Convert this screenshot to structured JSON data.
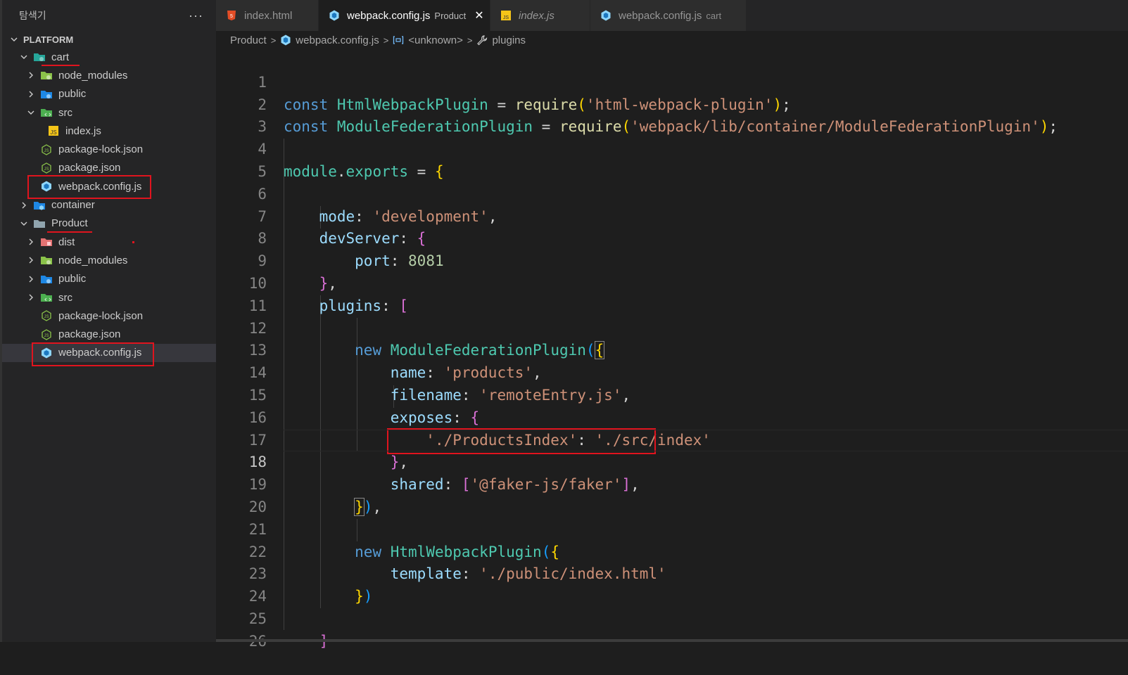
{
  "explorer": {
    "title": "탐색기",
    "more": "···",
    "root": "PLATFORM",
    "items": [
      {
        "label": "cart",
        "kind": "folder-open",
        "icon": "cart-folder-icon"
      },
      {
        "label": "node_modules",
        "kind": "folder",
        "icon": "node-folder-icon"
      },
      {
        "label": "public",
        "kind": "folder",
        "icon": "public-folder-icon"
      },
      {
        "label": "src",
        "kind": "folder-open",
        "icon": "src-folder-icon"
      },
      {
        "label": "index.js",
        "kind": "file",
        "icon": "js-file-icon"
      },
      {
        "label": "package-lock.json",
        "kind": "file",
        "icon": "nodejs-file-icon"
      },
      {
        "label": "package.json",
        "kind": "file",
        "icon": "nodejs-file-icon"
      },
      {
        "label": "webpack.config.js",
        "kind": "file",
        "icon": "webpack-icon"
      },
      {
        "label": "container",
        "kind": "folder",
        "icon": "container-folder-icon"
      },
      {
        "label": "Product",
        "kind": "folder-open",
        "icon": "folder-icon"
      },
      {
        "label": "dist",
        "kind": "folder",
        "icon": "dist-folder-icon"
      },
      {
        "label": "node_modules",
        "kind": "folder",
        "icon": "node-folder-icon"
      },
      {
        "label": "public",
        "kind": "folder",
        "icon": "public-folder-icon"
      },
      {
        "label": "src",
        "kind": "folder",
        "icon": "src-folder-icon"
      },
      {
        "label": "package-lock.json",
        "kind": "file",
        "icon": "nodejs-file-icon"
      },
      {
        "label": "package.json",
        "kind": "file",
        "icon": "nodejs-file-icon"
      },
      {
        "label": "webpack.config.js",
        "kind": "file",
        "icon": "webpack-icon"
      }
    ]
  },
  "tabs": [
    {
      "label": "index.html",
      "desc": "",
      "icon": "html-file-icon"
    },
    {
      "label": "webpack.config.js",
      "desc": "Product",
      "icon": "webpack-icon",
      "close": "✕"
    },
    {
      "label": "index.js",
      "desc": "",
      "icon": "js-file-icon"
    },
    {
      "label": "webpack.config.js",
      "desc": "cart",
      "icon": "webpack-icon"
    }
  ],
  "breadcrumb": {
    "folder": "Product",
    "file": "webpack.config.js",
    "symbol": "<unknown>",
    "property": "plugins"
  },
  "editor": {
    "current_line": 18,
    "line_numbers": [
      "1",
      "2",
      "3",
      "4",
      "5",
      "6",
      "7",
      "8",
      "9",
      "10",
      "11",
      "12",
      "13",
      "14",
      "15",
      "16",
      "17",
      "18",
      "19",
      "20",
      "21",
      "22",
      "23",
      "24",
      "25",
      "26"
    ],
    "code": {
      "const": "const",
      "html_plugin": "HtmlWebpackPlugin",
      "mf_plugin": "ModuleFederationPlugin",
      "require": "require",
      "html_plugin_str": "'html-webpack-plugin'",
      "mf_plugin_str": "'webpack/lib/container/ModuleFederationPlugin'",
      "module": "module",
      "exports": "exports",
      "mode": "mode",
      "mode_val": "'development'",
      "devServer": "devServer",
      "port": "port",
      "port_val": "8081",
      "plugins": "plugins",
      "new": "new",
      "name": "name",
      "name_val": "'products'",
      "filename": "filename",
      "filename_val": "'remoteEntry.js'",
      "exposes": "exposes",
      "expose_key": "'./ProductsIndex'",
      "expose_val": "'./src/index'",
      "shared": "shared",
      "shared_val": "'@faker-js/faker'",
      "template": "template",
      "template_val": "'./public/index.html'"
    }
  },
  "colors": {
    "highlight": "#e0141e",
    "keyword": "#569cd6",
    "class": "#4ec9b0",
    "string": "#ce9178"
  }
}
